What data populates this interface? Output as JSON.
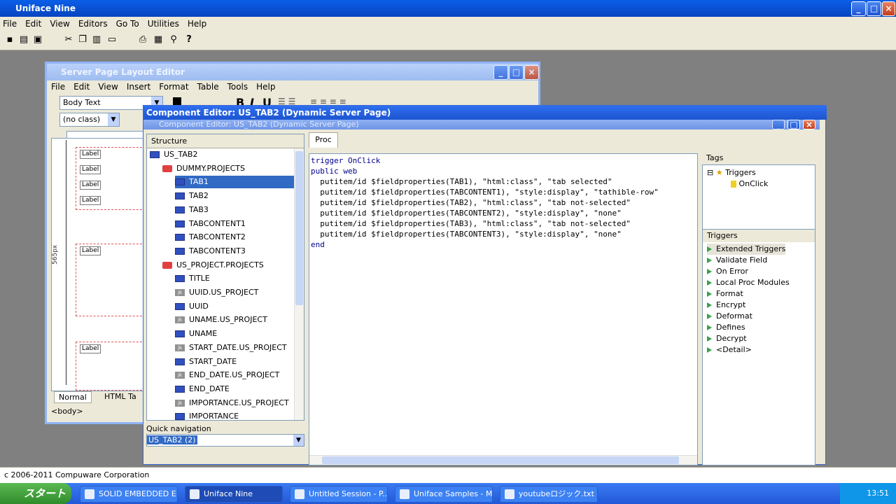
{
  "app": {
    "title": "Uniface Nine",
    "menu": [
      "File",
      "Edit",
      "View",
      "Editors",
      "Go To",
      "Utilities",
      "Help"
    ]
  },
  "toolbar_icons": [
    "show-icon",
    "stacked-windows-icon",
    "save-icon",
    "cut-icon",
    "copy-icon",
    "paste-icon",
    "new-icon",
    "print-icon",
    "properties-icon",
    "find-icon",
    "help-icon"
  ],
  "layout_editor": {
    "title": "Server Page Layout Editor",
    "menu": [
      "File",
      "Edit",
      "View",
      "Insert",
      "Format",
      "Table",
      "Tools",
      "Help"
    ],
    "style_combo": "Body Text",
    "class_combo": "(no class)",
    "labels": [
      "Label",
      "Label",
      "Label",
      "Label",
      "Label",
      "Label"
    ],
    "ruler": "565px",
    "tabs": [
      "Normal",
      "HTML Ta"
    ],
    "body_tag": "<body>"
  },
  "component_editor": {
    "title": "Component Editor: US_TAB2 (Dynamic Server Page)",
    "title_ghost": "Component Editor: US_TAB2 (Dynamic Server Page)",
    "structure_header": "Structure",
    "tree": [
      {
        "label": "US_TAB2",
        "type": "root",
        "level": 0
      },
      {
        "label": "DUMMY.PROJECTS",
        "type": "entity",
        "level": 1
      },
      {
        "label": "TAB1",
        "type": "field",
        "level": 2,
        "selected": true
      },
      {
        "label": "TAB2",
        "type": "field",
        "level": 2
      },
      {
        "label": "TAB3",
        "type": "field",
        "level": 2
      },
      {
        "label": "TABCONTENT1",
        "type": "field",
        "level": 2
      },
      {
        "label": "TABCONTENT2",
        "type": "field",
        "level": 2
      },
      {
        "label": "TABCONTENT3",
        "type": "field",
        "level": 2
      },
      {
        "label": "US_PROJECT.PROJECTS",
        "type": "entity",
        "level": 1
      },
      {
        "label": "TITLE",
        "type": "field",
        "level": 2
      },
      {
        "label": "UUID.US_PROJECT",
        "type": "key",
        "level": 2
      },
      {
        "label": "UUID",
        "type": "field",
        "level": 2
      },
      {
        "label": "UNAME.US_PROJECT",
        "type": "key",
        "level": 2
      },
      {
        "label": "UNAME",
        "type": "field",
        "level": 2
      },
      {
        "label": "START_DATE.US_PROJECT",
        "type": "key",
        "level": 2
      },
      {
        "label": "START_DATE",
        "type": "field",
        "level": 2
      },
      {
        "label": "END_DATE.US_PROJECT",
        "type": "key",
        "level": 2
      },
      {
        "label": "END_DATE",
        "type": "field",
        "level": 2
      },
      {
        "label": "IMPORTANCE.US_PROJECT",
        "type": "key",
        "level": 2
      },
      {
        "label": "IMPORTANCE",
        "type": "field",
        "level": 2
      }
    ],
    "quick_nav_label": "Quick navigation",
    "quick_nav_value": "US_TAB2 (2)",
    "proc_tab": "Proc",
    "code": [
      "trigger OnClick",
      "public web",
      "  putitem/id $fieldproperties(TAB1), \"html:class\", \"tab selected\"",
      "  putitem/id $fieldproperties(TABCONTENT1), \"style:display\", \"tathible-row\"",
      "  putitem/id $fieldproperties(TAB2), \"html:class\", \"tab not-selected\"",
      "  putitem/id $fieldproperties(TABCONTENT2), \"style:display\", \"none\"",
      "  putitem/id $fieldproperties(TAB3), \"html:class\", \"tab not-selected\"",
      "  putitem/id $fieldproperties(TABCONTENT3), \"style:display\", \"none\"",
      "end"
    ],
    "tags_label": "Tags",
    "tags": {
      "root": "Triggers",
      "child": "OnClick"
    },
    "triggers_header": "Triggers",
    "triggers": [
      "Extended Triggers",
      "Validate Field",
      "On Error",
      "Local Proc Modules",
      "Format",
      "Encrypt",
      "Deformat",
      "Defines",
      "Decrypt",
      "<Detail>"
    ]
  },
  "status": "c 2006-2011 Compuware Corporation",
  "taskbar": {
    "start": "スタート",
    "tasks": [
      "SOLID EMBEDDED E...",
      "Uniface Nine",
      "Untitled Session - P...",
      "Uniface Samples - M...",
      "youtubeロジック.txt - ..."
    ],
    "clock": "13:51"
  }
}
